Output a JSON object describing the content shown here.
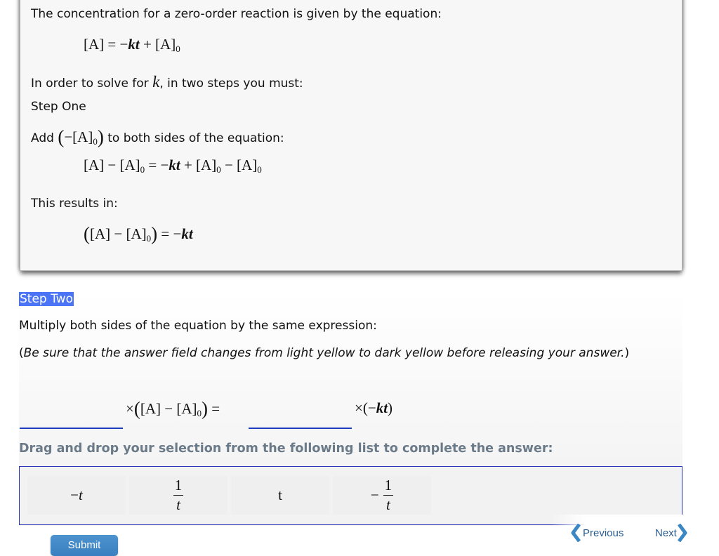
{
  "step_one_card": {
    "intro": "The concentration for a zero-order reaction is given by the equation:",
    "equation_1": "[A] = −kt + [A]₀",
    "solve_prefix": "In order to solve for",
    "solve_var": "k",
    "solve_suffix": ", in two steps you must:",
    "step_label": "Step One",
    "add_prefix": "Add",
    "add_term": "(−[A]₀)",
    "add_suffix": "to both sides of the equation:",
    "equation_2": "[A] − [A]₀ = −kt + [A]₀ − [A]₀",
    "results_label": "This results in:",
    "equation_3": "([A] − [A]₀) = −kt"
  },
  "step_two": {
    "label": "Step Two",
    "instruction": "Multiply both sides of the equation by the same expression:",
    "note_open": "(",
    "note_italic": "Be sure that the answer field changes from light yellow to dark yellow before releasing your answer.",
    "note_close": ")",
    "equation_left": "× ([A] − [A]₀) =",
    "equation_right": "×(−kt)",
    "blanks": [
      {
        "name": "left-multiplier",
        "value": ""
      },
      {
        "name": "right-multiplier",
        "value": ""
      }
    ],
    "drag_instruction": "Drag and drop your selection from the following list to complete the answer:",
    "choices": [
      {
        "label": "−t",
        "kind": "plain",
        "sign": "−",
        "text": "t"
      },
      {
        "label": "1/t",
        "kind": "fraction",
        "sign": "",
        "num": "1",
        "den": "t"
      },
      {
        "label": "t",
        "kind": "plain",
        "sign": "",
        "text": "t"
      },
      {
        "label": "−1/t",
        "kind": "fraction",
        "sign": "−",
        "num": "1",
        "den": "t"
      }
    ]
  },
  "buttons": {
    "submit": "Submit",
    "previous": "Previous",
    "next": "Next"
  },
  "colors": {
    "highlight": "#4a74f5",
    "blank_underline": "#1d3bbf",
    "tray_border": "#2a36b8",
    "instruction_gray": "#6b7a88",
    "nav_chevron": "#3b87c4",
    "submit_blue": "#4489c8"
  }
}
